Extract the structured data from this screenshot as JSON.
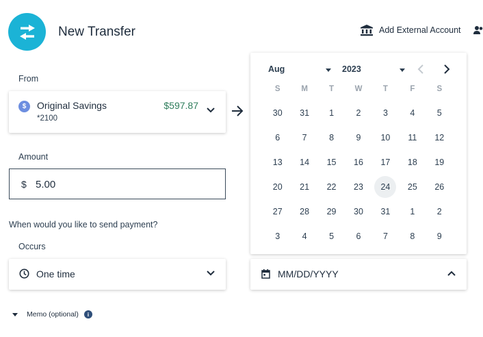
{
  "header": {
    "title": "New Transfer",
    "add_external_label": "Add External Account"
  },
  "from": {
    "label": "From",
    "account_name": "Original Savings",
    "account_number": "*2100",
    "balance": "$597.87",
    "balance_color": "#2e7d5b"
  },
  "amount": {
    "label": "Amount",
    "currency_symbol": "$",
    "value": "5.00"
  },
  "schedule": {
    "question": "When would you like to send payment?",
    "occurs_label": "Occurs",
    "occurs_value": "One time",
    "date_placeholder": "MM/DD/YYYY"
  },
  "calendar": {
    "month": "Aug",
    "year": "2023",
    "weekdays": [
      "S",
      "M",
      "T",
      "W",
      "T",
      "F",
      "S"
    ],
    "days": [
      "30",
      "31",
      "1",
      "2",
      "3",
      "4",
      "5",
      "6",
      "7",
      "8",
      "9",
      "10",
      "11",
      "12",
      "13",
      "14",
      "15",
      "16",
      "17",
      "18",
      "19",
      "20",
      "21",
      "22",
      "23",
      "24",
      "25",
      "26",
      "27",
      "28",
      "29",
      "30",
      "31",
      "1",
      "2",
      "3",
      "4",
      "5",
      "6",
      "7",
      "8",
      "9"
    ],
    "today": "24"
  },
  "memo": {
    "label": "Memo (optional)",
    "info_glyph": "i"
  },
  "icons": {
    "dollar_glyph": "$"
  },
  "colors": {
    "accent": "#1bb3d6",
    "card_icon": "#6d8ee0"
  }
}
